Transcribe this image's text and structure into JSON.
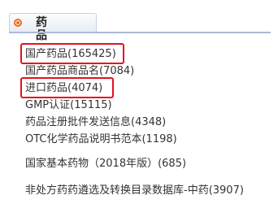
{
  "header": {
    "title": "药 品",
    "icon": "bullet-circle-icon",
    "accent_color": "#ec6b23"
  },
  "links": [
    {
      "label": "国产药品(165425)",
      "highlighted": true
    },
    {
      "label": "国产药品商品名(7084)",
      "highlighted": false
    },
    {
      "label": "进口药品(4074)",
      "highlighted": true
    },
    {
      "label": "GMP认证(15115)",
      "highlighted": false
    },
    {
      "label": "药品注册批件发送信息(4348)",
      "highlighted": false
    },
    {
      "label": "OTC化学药品说明书范本(1198)",
      "highlighted": false
    },
    {
      "label": "国家基本药物（2018年版）(685)",
      "highlighted": false
    },
    {
      "label": "非处方药药遴选及转换目录数据库-中药(3907)",
      "highlighted": false
    }
  ],
  "highlight_color": "#e8101c",
  "link_color": "#333333"
}
